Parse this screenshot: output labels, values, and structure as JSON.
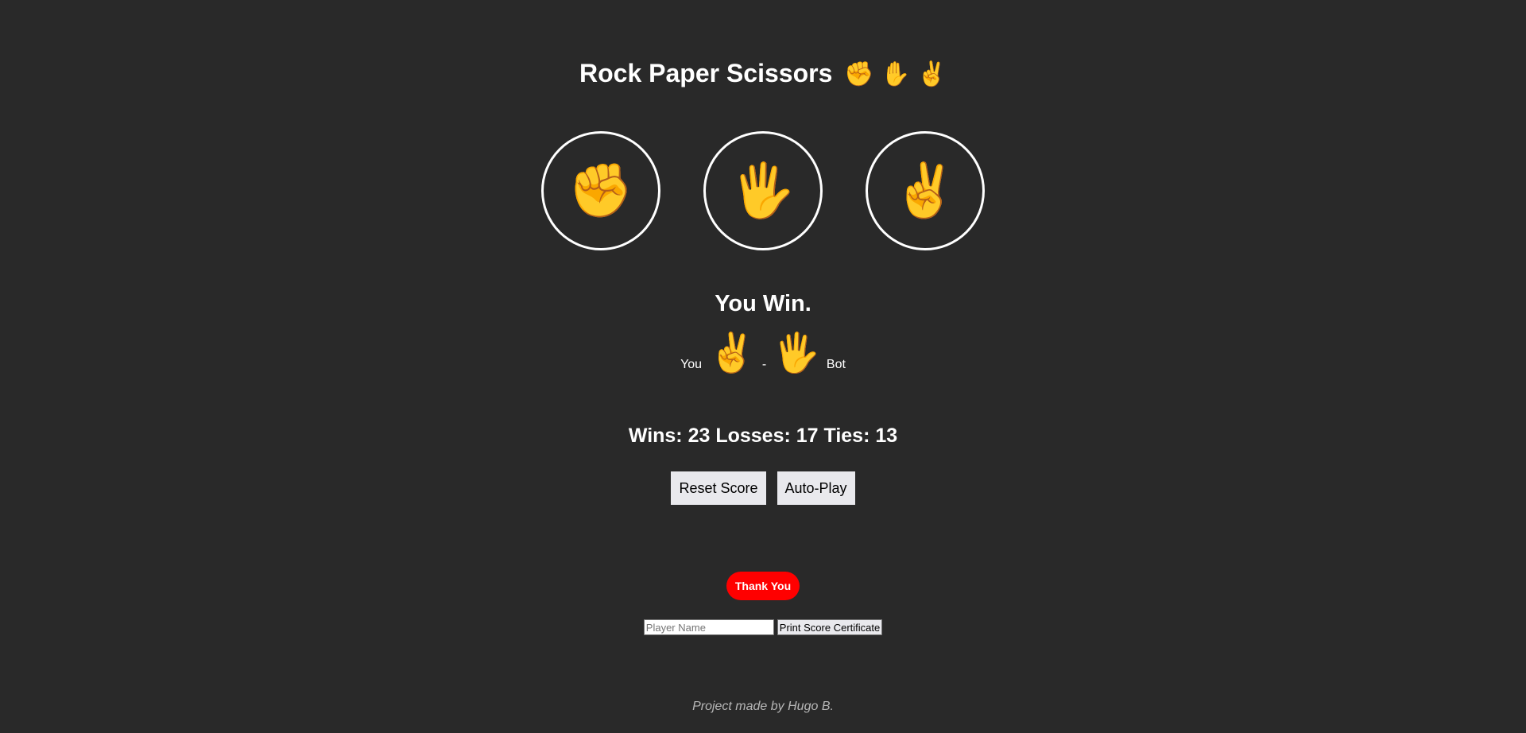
{
  "header": {
    "title": "Rock Paper Scissors",
    "title_emojis": "✊ ✋ ✌️"
  },
  "moves": [
    {
      "name": "rock",
      "emoji": "✊"
    },
    {
      "name": "paper",
      "emoji": "🖐️"
    },
    {
      "name": "scissors",
      "emoji": "✌️"
    }
  ],
  "result": {
    "text": "You Win.",
    "you_label": "You",
    "you_move": "✌️",
    "separator": "-",
    "bot_move": "🖐️",
    "bot_label": "Bot"
  },
  "score": {
    "text": "Wins: 23 Losses: 17 Ties: 13"
  },
  "controls": {
    "reset_label": "Reset Score",
    "autoplay_label": "Auto-Play"
  },
  "thanks": {
    "label": "Thank You"
  },
  "certificate": {
    "name_placeholder": "Player Name",
    "name_value": "",
    "print_label": "Print Score Certificate"
  },
  "footer": {
    "credit": "Project made by Hugo B."
  },
  "colors": {
    "background": "#292929",
    "text": "#ffffff",
    "thanks_button": "#ff0000",
    "button_bg": "#e9e9ed",
    "footer_text": "#b7b7b7"
  }
}
